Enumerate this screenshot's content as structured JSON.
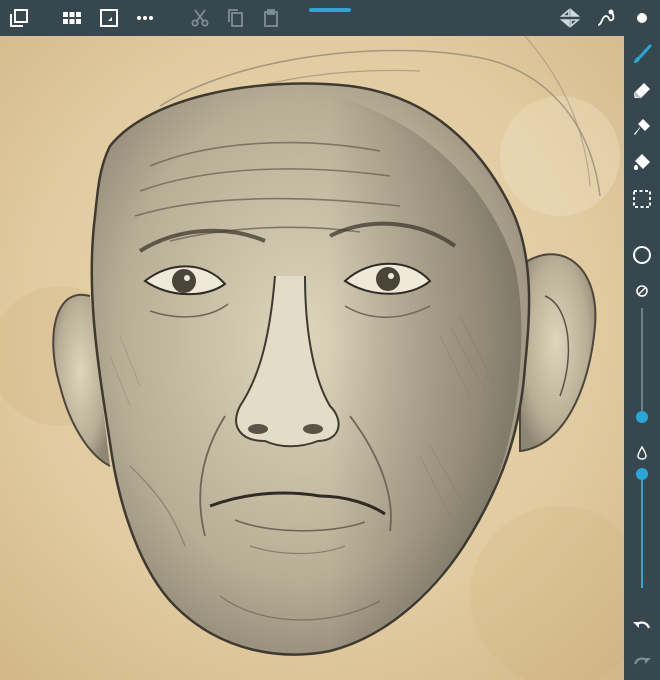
{
  "app": {
    "accent_color": "#29a7d6",
    "toolbar_color": "#36474f",
    "canvas_description_color": "#e6d3ad"
  },
  "toolbar": {
    "left": [
      {
        "name": "layers-icon"
      },
      {
        "name": "grid-menu-icon"
      },
      {
        "name": "canvas-resize-icon"
      },
      {
        "name": "more-options-icon"
      },
      {
        "name": "cut-icon"
      },
      {
        "name": "copy-icon"
      },
      {
        "name": "paste-icon"
      }
    ],
    "right": [
      {
        "name": "symmetry-icon"
      },
      {
        "name": "stroke-path-icon"
      },
      {
        "name": "color-dot-icon"
      }
    ]
  },
  "sidebar": {
    "tools": [
      {
        "name": "brush-tool-icon",
        "active": true
      },
      {
        "name": "eraser-tool-icon",
        "active": false
      },
      {
        "name": "smudge-tool-icon",
        "active": false
      },
      {
        "name": "fill-tool-icon",
        "active": false
      },
      {
        "name": "selection-tool-icon",
        "active": false
      }
    ],
    "brush_size_fraction": 0.34,
    "brush_opacity_fraction": 1.0,
    "undo": "undo-icon",
    "redo": "redo-icon"
  }
}
